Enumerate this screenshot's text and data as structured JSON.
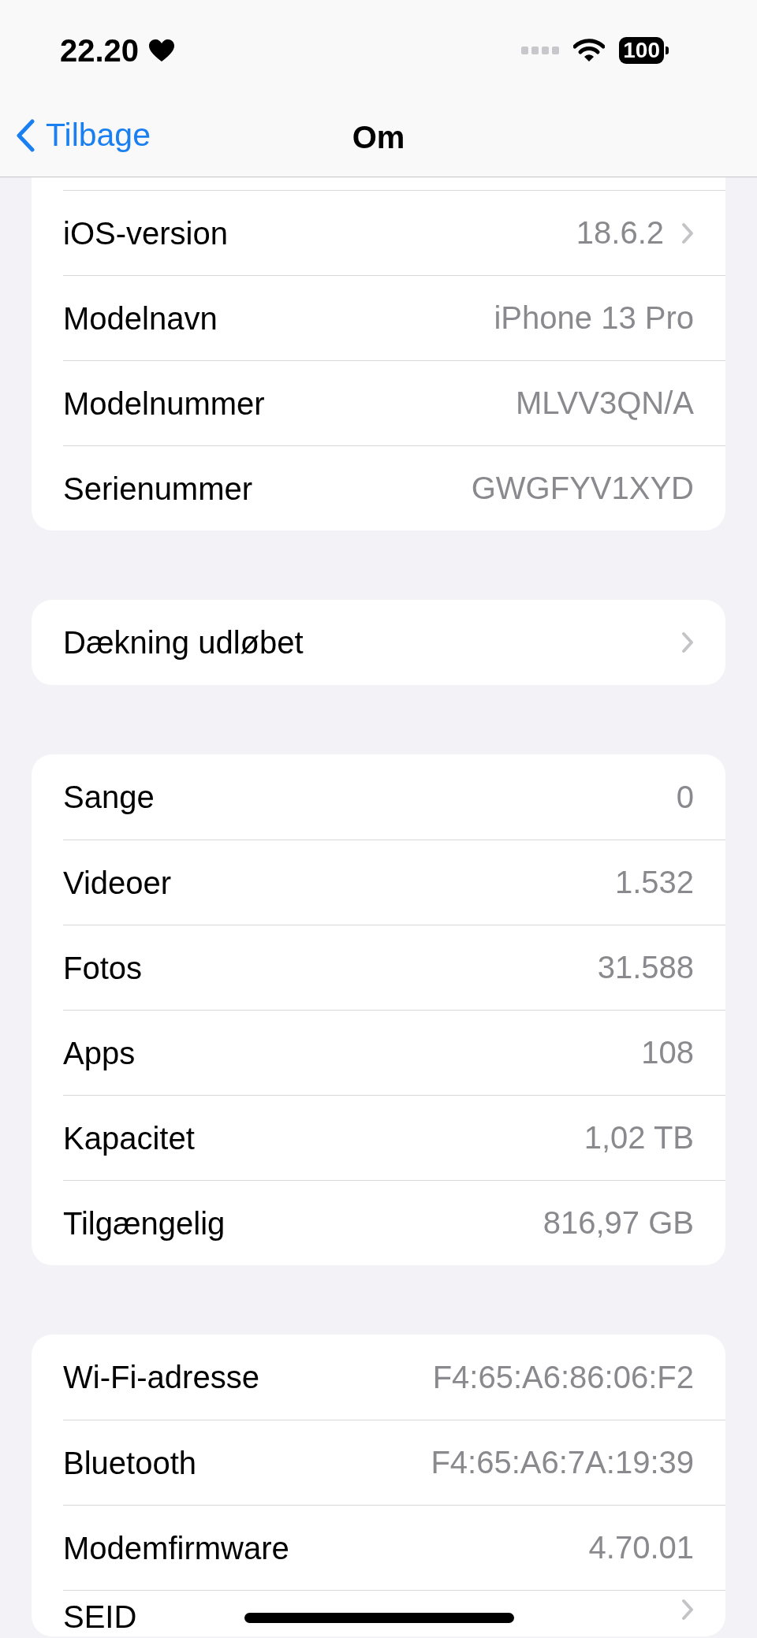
{
  "status_bar": {
    "time": "22.20",
    "battery": "100"
  },
  "nav_bar": {
    "back": "Tilbage",
    "title": "Om"
  },
  "groups": [
    {
      "rows": [
        {
          "label": "iOS-version",
          "value": "18.6.2",
          "chevron": true
        },
        {
          "label": "Modelnavn",
          "value": "iPhone 13 Pro",
          "chevron": false
        },
        {
          "label": "Modelnummer",
          "value": "MLVV3QN/A",
          "chevron": false
        },
        {
          "label": "Serienummer",
          "value": "GWGFYV1XYD",
          "chevron": false
        }
      ]
    },
    {
      "rows": [
        {
          "label": "Dækning udløbet",
          "chevron": true
        }
      ]
    },
    {
      "rows": [
        {
          "label": "Sange",
          "value": "0",
          "chevron": false
        },
        {
          "label": "Videoer",
          "value": "1.532",
          "chevron": false
        },
        {
          "label": "Fotos",
          "value": "31.588",
          "chevron": false
        },
        {
          "label": "Apps",
          "value": "108",
          "chevron": false
        },
        {
          "label": "Kapacitet",
          "value": "1,02 TB",
          "chevron": false
        },
        {
          "label": "Tilgængelig",
          "value": "816,97 GB",
          "chevron": false
        }
      ]
    },
    {
      "rows": [
        {
          "label": "Wi-Fi-adresse",
          "value": "F4:65:A6:86:06:F2",
          "chevron": false
        },
        {
          "label": "Bluetooth",
          "value": "F4:65:A6:7A:19:39",
          "chevron": false
        },
        {
          "label": "Modemfirmware",
          "value": "4.70.01",
          "chevron": false
        },
        {
          "label": "SEID",
          "chevron": true
        }
      ]
    }
  ]
}
